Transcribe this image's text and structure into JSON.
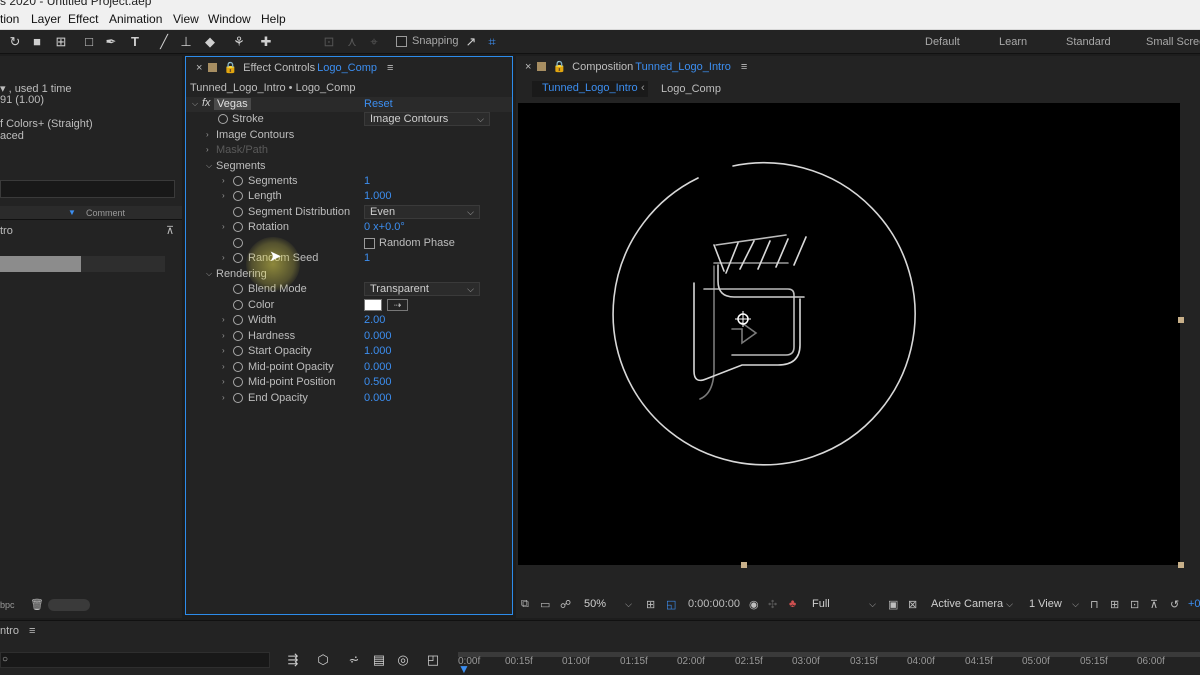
{
  "window": {
    "title": "s 2020 - Untitled Project.aep"
  },
  "menu": [
    "tion",
    "Layer",
    "Effect",
    "Animation",
    "View",
    "Window",
    "Help"
  ],
  "toolbar": {
    "snapping_label": "Snapping",
    "workspaces": [
      "Default",
      "Learn",
      "Standard",
      "Small Scree"
    ]
  },
  "project_panel": {
    "info_line1": ", used 1 time",
    "info_line2": "91 (1.00)",
    "info_line3": "f Colors+ (Straight)",
    "info_line4": "aced",
    "column_comment": "Comment",
    "item_name": "tro",
    "bpc_label": "bpc"
  },
  "effect_controls": {
    "tab_prefix": "Effect Controls",
    "tab_layer": "Logo_Comp",
    "breadcrumb": "Tunned_Logo_Intro • Logo_Comp",
    "effect_name": "Vegas",
    "reset_label": "Reset",
    "stroke_label": "Stroke",
    "stroke_value": "Image Contours",
    "image_contours": "Image Contours",
    "mask_path": "Mask/Path",
    "segments_group": "Segments",
    "segments_label": "Segments",
    "segments_value": "1",
    "length_label": "Length",
    "length_value": "1.000",
    "seg_dist_label": "Segment Distribution",
    "seg_dist_value": "Even",
    "rotation_label": "Rotation",
    "rotation_value": "0 x+0.0°",
    "random_phase_label": "Random Phase",
    "random_seed_label": "Random Seed",
    "random_seed_value": "1",
    "rendering_group": "Rendering",
    "blend_mode_label": "Blend Mode",
    "blend_mode_value": "Transparent",
    "color_label": "Color",
    "color_swatch": "#ffffff",
    "width_label": "Width",
    "width_value": "2.00",
    "hardness_label": "Hardness",
    "hardness_value": "0.000",
    "start_opacity_label": "Start Opacity",
    "start_opacity_value": "1.000",
    "mid_opacity_label": "Mid-point Opacity",
    "mid_opacity_value": "0.000",
    "mid_position_label": "Mid-point Position",
    "mid_position_value": "0.500",
    "end_opacity_label": "End Opacity",
    "end_opacity_value": "0.000"
  },
  "composition": {
    "tab_prefix": "Composition",
    "tab_name": "Tunned_Logo_Intro",
    "flow_active": "Tunned_Logo_Intro",
    "flow_child": "Logo_Comp",
    "zoom": "50%",
    "timecode": "0:00:00:00",
    "resolution": "Full",
    "camera": "Active Camera",
    "views": "1 View",
    "exposure": "+0."
  },
  "timeline": {
    "tab_name": "ntro",
    "ticks": [
      "0:00f",
      "00:15f",
      "01:00f",
      "01:15f",
      "02:00f",
      "02:15f",
      "03:00f",
      "03:15f",
      "04:00f",
      "04:15f",
      "05:00f",
      "05:15f",
      "06:00f"
    ]
  },
  "colors": {
    "accent": "#3c8ef0",
    "panel": "#232323",
    "viewer": "#000000",
    "focus_border": "#2d8ceb"
  }
}
